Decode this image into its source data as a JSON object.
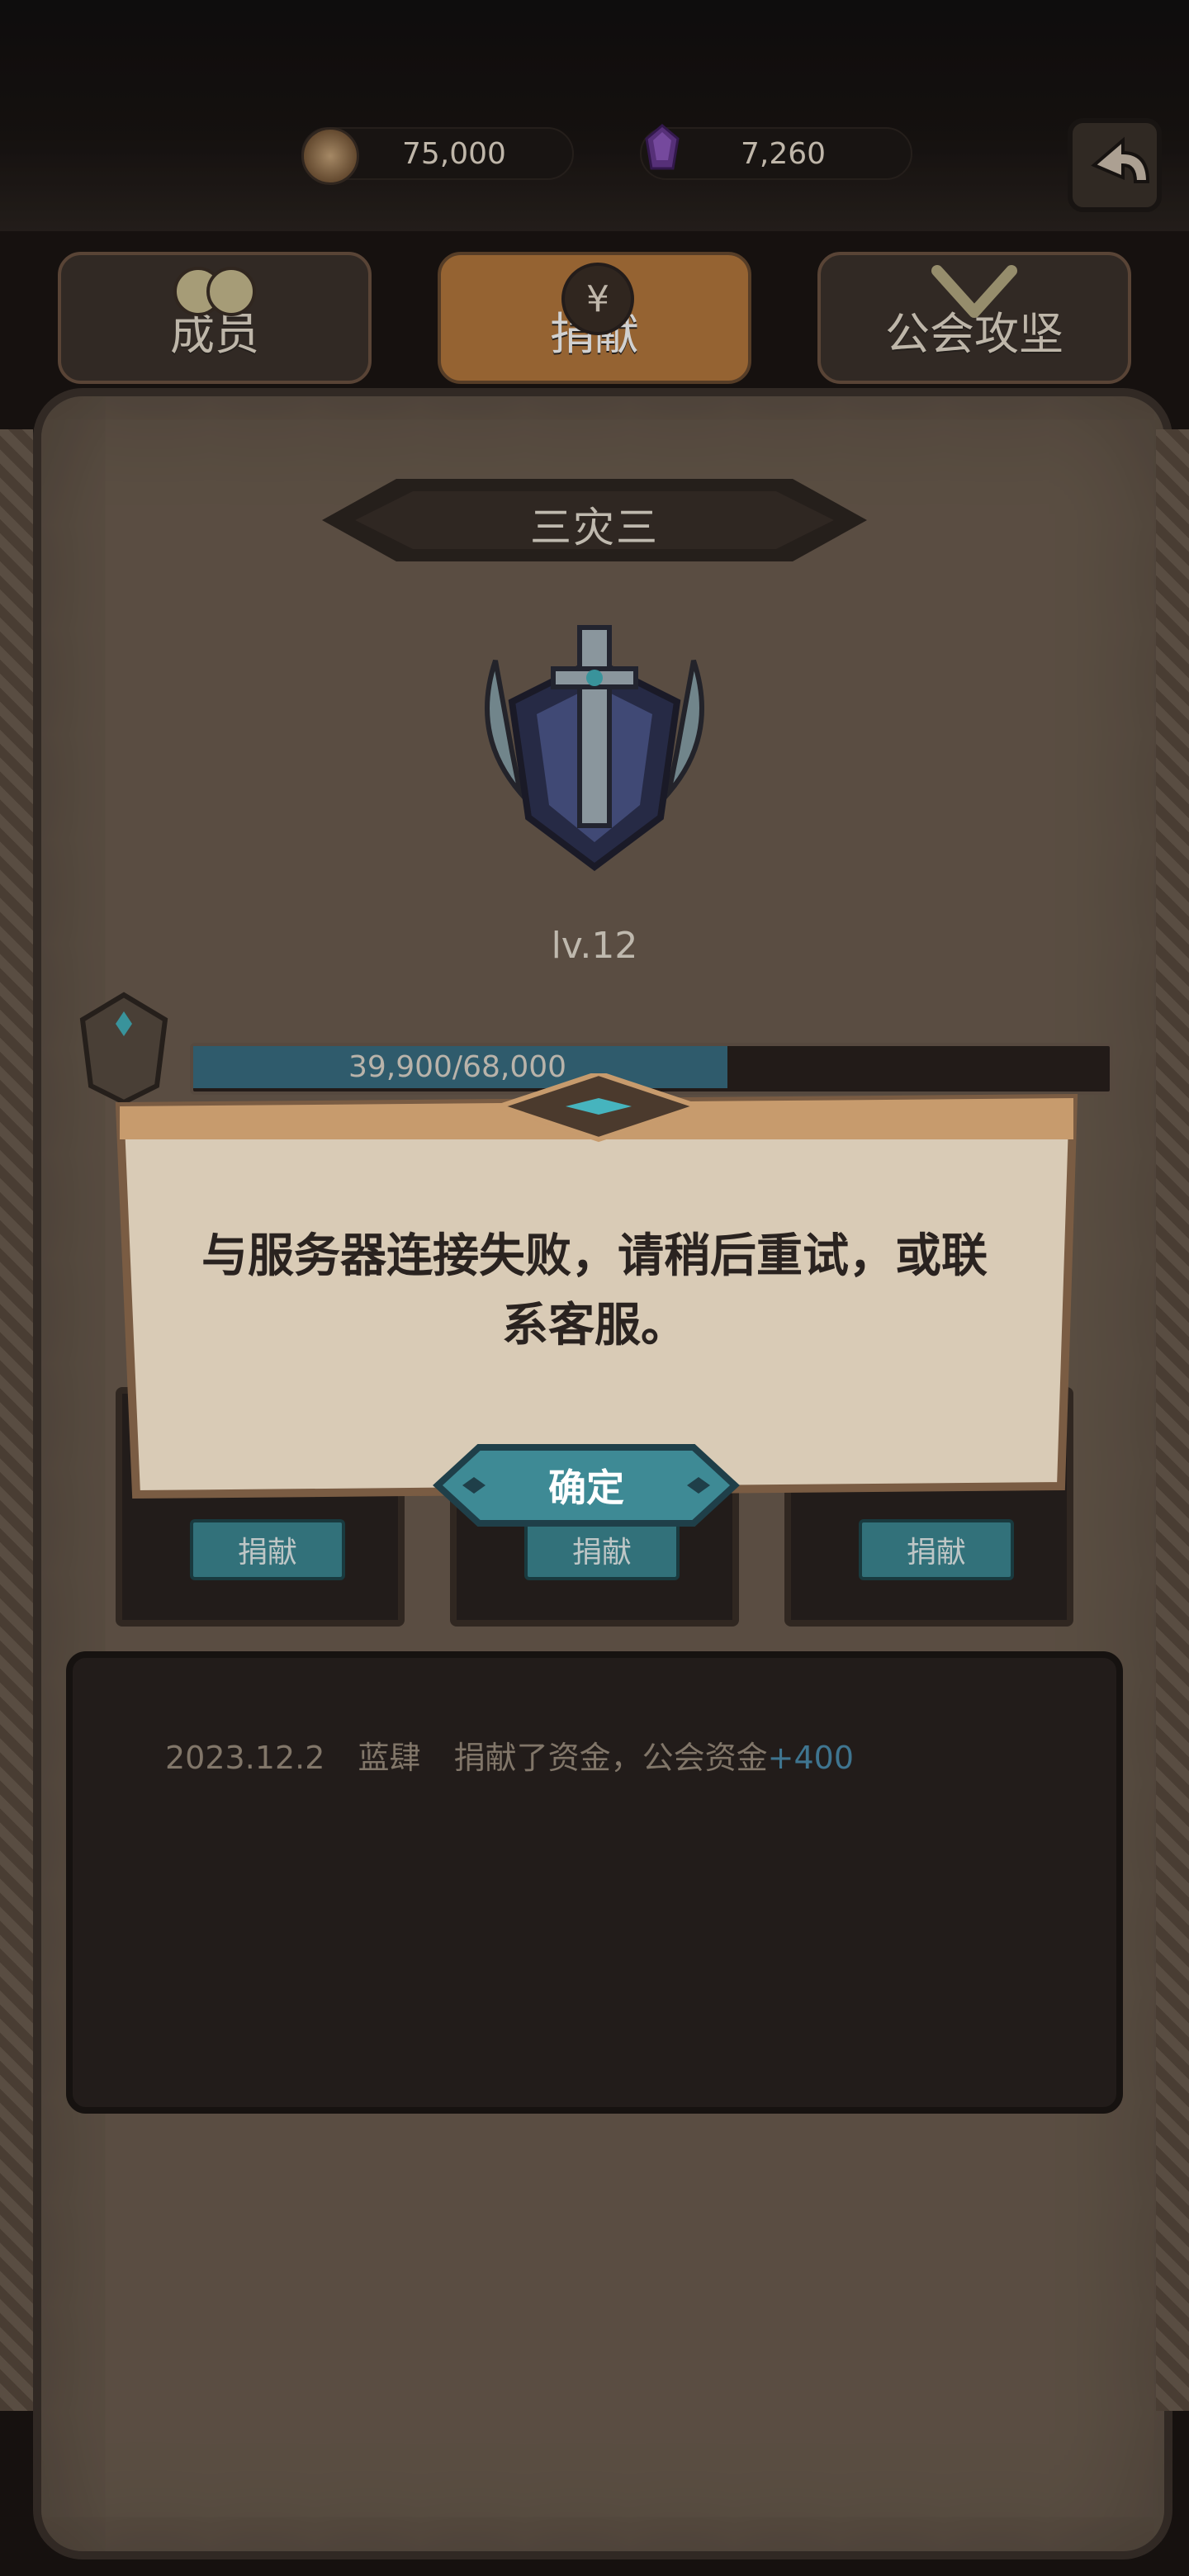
{
  "header": {
    "coins": "75,000",
    "gems": "7,260"
  },
  "tabs": [
    {
      "label": "成员",
      "icon": "members-icon"
    },
    {
      "label": "捐献",
      "icon": "yen-coin-icon"
    },
    {
      "label": "公会攻坚",
      "icon": "crossed-swords-icon"
    }
  ],
  "guild": {
    "name": "三灾三",
    "level": "lv.12",
    "xp_text": "39,900/68,000",
    "xp_progress": 0.587
  },
  "donate": {
    "buttons": [
      "捐献",
      "捐献",
      "捐献"
    ]
  },
  "history": {
    "date": "2023.12.2",
    "user": "蓝肆",
    "text": "捐献了资金，公会资金",
    "plus": "+400"
  },
  "dialog": {
    "message": "与服务器连接失败，请稍后重试，或联系客服。",
    "confirm_label": "确定"
  },
  "colors": {
    "accent_teal": "#3e8a95",
    "panel_bg": "#6e5f51",
    "tab_active": "#b6793d",
    "xp_fill": "#3a7084",
    "history_plus": "#4d8fb0"
  }
}
